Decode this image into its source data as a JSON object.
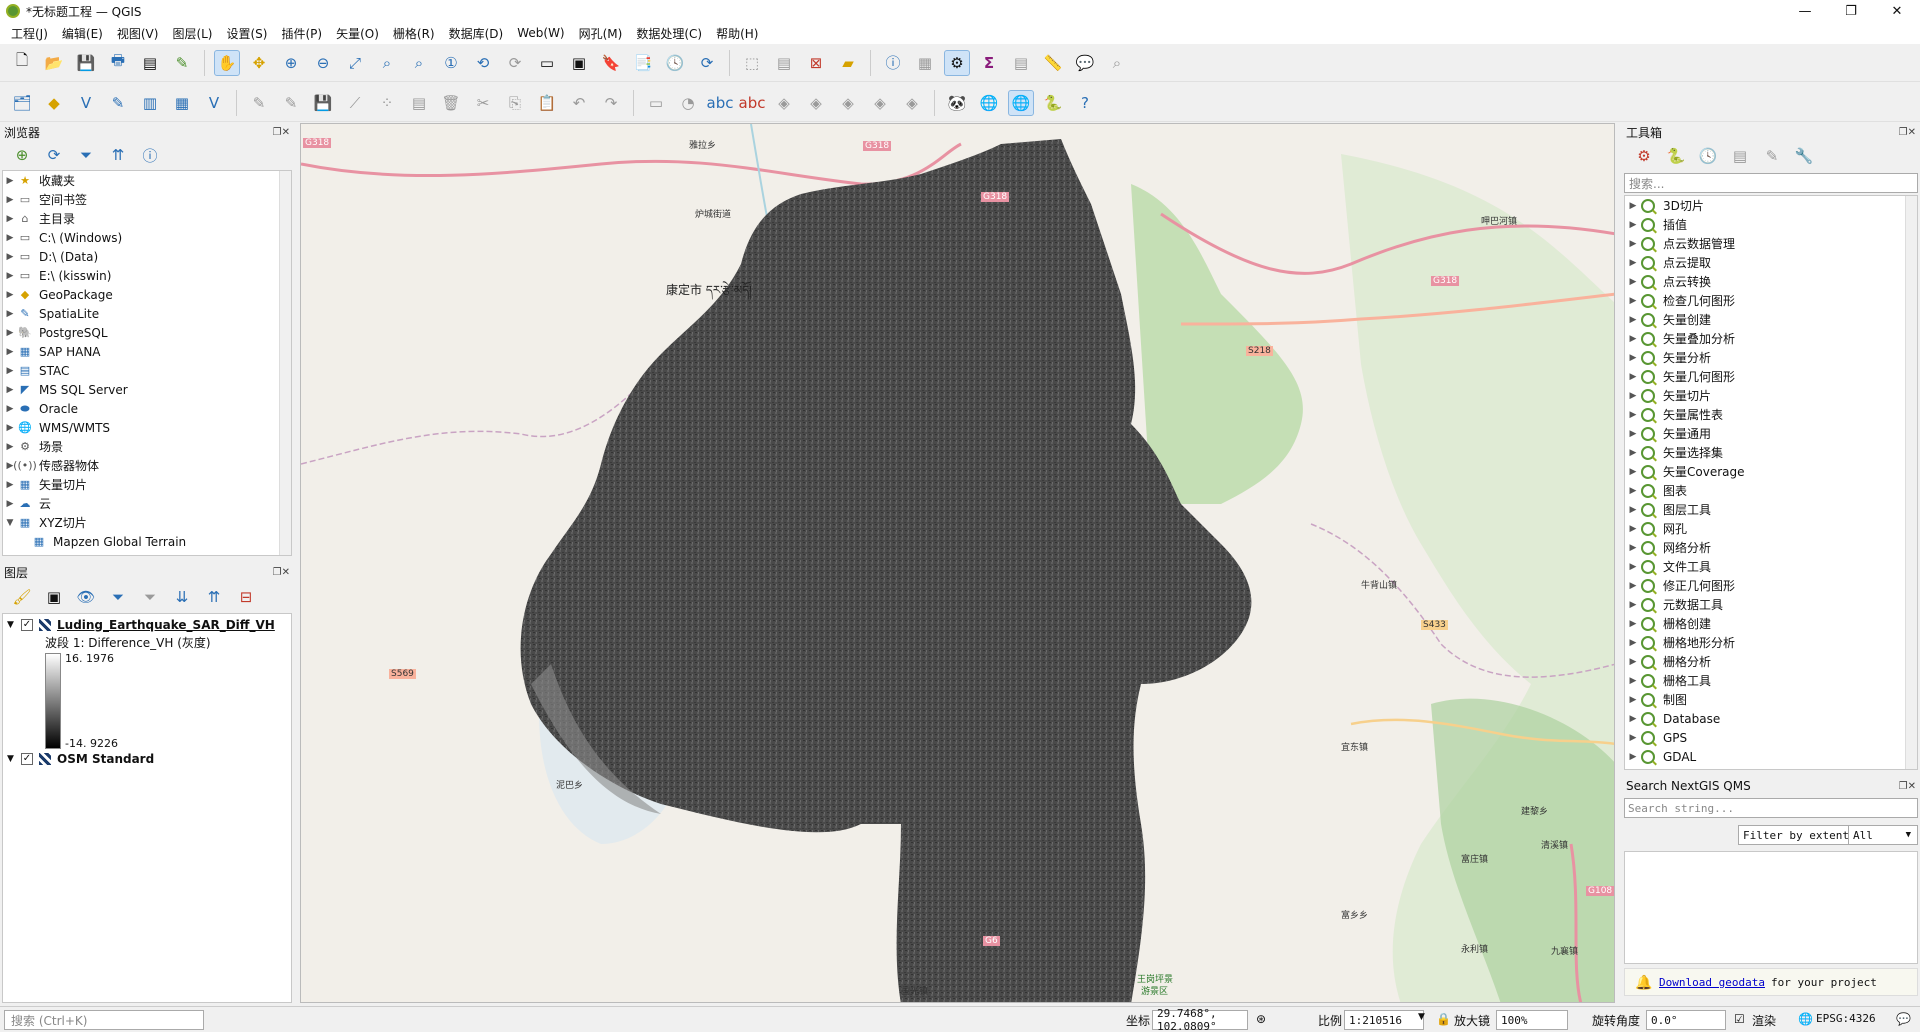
{
  "window": {
    "title": "*无标题工程 — QGIS",
    "minimize": "—",
    "maximize": "❐",
    "close": "✕"
  },
  "menu": [
    "工程(J)",
    "编辑(E)",
    "视图(V)",
    "图层(L)",
    "设置(S)",
    "插件(P)",
    "矢量(O)",
    "栅格(R)",
    "数据库(D)",
    "Web(W)",
    "网孔(M)",
    "数据处理(C)",
    "帮助(H)"
  ],
  "browser": {
    "title": "浏览器",
    "items": [
      {
        "label": "收藏夹",
        "icon": "star-icon",
        "glyph": "★"
      },
      {
        "label": "空间书签",
        "icon": "bookmark-icon",
        "glyph": "▭"
      },
      {
        "label": "主目录",
        "icon": "home-folder-icon",
        "glyph": "⌂"
      },
      {
        "label": "C:\\ (Windows)",
        "icon": "drive-icon",
        "glyph": "▭"
      },
      {
        "label": "D:\\ (Data)",
        "icon": "drive-icon",
        "glyph": "▭"
      },
      {
        "label": "E:\\ (kisswin)",
        "icon": "drive-icon",
        "glyph": "▭"
      },
      {
        "label": "GeoPackage",
        "icon": "geopackage-icon",
        "glyph": "◆"
      },
      {
        "label": "SpatiaLite",
        "icon": "spatialite-icon",
        "glyph": "✎"
      },
      {
        "label": "PostgreSQL",
        "icon": "postgresql-icon",
        "glyph": "🐘"
      },
      {
        "label": "SAP HANA",
        "icon": "sap-hana-icon",
        "glyph": "▦"
      },
      {
        "label": "STAC",
        "icon": "stac-icon",
        "glyph": "▤"
      },
      {
        "label": "MS SQL Server",
        "icon": "mssql-icon",
        "glyph": "◤"
      },
      {
        "label": "Oracle",
        "icon": "oracle-icon",
        "glyph": "⬬"
      },
      {
        "label": "WMS/WMTS",
        "icon": "wms-icon",
        "glyph": "🌐"
      },
      {
        "label": "场景",
        "icon": "scene-icon",
        "glyph": "⚙"
      },
      {
        "label": "传感器物体",
        "icon": "sensor-icon",
        "glyph": "((•))"
      },
      {
        "label": "矢量切片",
        "icon": "vector-tile-icon",
        "glyph": "▦"
      },
      {
        "label": "云",
        "icon": "cloud-icon",
        "glyph": "☁"
      },
      {
        "label": "XYZ切片",
        "icon": "xyz-tile-icon",
        "glyph": "▦"
      },
      {
        "label": "Mapzen Global Terrain",
        "icon": "xyz-layer-icon",
        "glyph": "▦"
      }
    ]
  },
  "layers": {
    "title": "图层",
    "items": [
      {
        "name": "Luding_Earthquake_SAR_Diff_VH",
        "checked": "✓"
      },
      {
        "name": "OSM Standard",
        "checked": "✓"
      }
    ],
    "band": "波段 1: Difference_VH (灰度)",
    "legend_max": "16. 1976",
    "legend_min": "-14. 9226"
  },
  "toolbox": {
    "title": "工具箱",
    "search_placeholder": "搜索...",
    "items": [
      "3D切片",
      "插值",
      "点云数据管理",
      "点云提取",
      "点云转换",
      "检查几何图形",
      "矢量创建",
      "矢量叠加分析",
      "矢量分析",
      "矢量几何图形",
      "矢量切片",
      "矢量属性表",
      "矢量通用",
      "矢量选择集",
      "矢量Coverage",
      "图表",
      "图层工具",
      "网孔",
      "网络分析",
      "文件工具",
      "修正几何图形",
      "元数据工具",
      "栅格创建",
      "栅格地形分析",
      "栅格分析",
      "栅格工具",
      "制图",
      "Database",
      "GPS",
      "GDAL"
    ]
  },
  "qms": {
    "title": "Search NextGIS QMS",
    "placeholder": "Search string...",
    "filter_button": "Filter by extent",
    "filter_select": "All",
    "download_link": "Download geodata",
    "download_suffix": "for your project"
  },
  "map": {
    "labels": [
      "G318",
      "雅拉乡",
      "G318",
      "G318",
      "炉城街道",
      "康定市 དར་རྩེ་མདོ།",
      "G318",
      "呷巴河镇",
      "S218",
      "S569",
      "牛背山镇",
      "S433",
      "宜东镇",
      "建黎乡",
      "清溪镇",
      "富庄镇",
      "G108",
      "富乡乡",
      "九襄镇",
      "永利镇",
      "G6",
      "国光镇",
      "王岗坪景",
      "游景区",
      "泥巴乡"
    ]
  },
  "status": {
    "search_placeholder": "搜索 (Ctrl+K)",
    "coord_label": "坐标",
    "coord_value": "29.7468°, 102.0809°",
    "scale_label": "比例",
    "scale_value": "1:210516",
    "magnifier_label": "放大镜",
    "magnifier_value": "100%",
    "rotation_label": "旋转角度",
    "rotation_value": "0.0°",
    "render_label": "渲染",
    "crs": "EPSG:4326"
  },
  "colors": {
    "accent": "#589632",
    "map_bg": "#f2efe9",
    "forest": "#add19e",
    "road_primary": "#e892a2",
    "water": "#aad3df"
  }
}
